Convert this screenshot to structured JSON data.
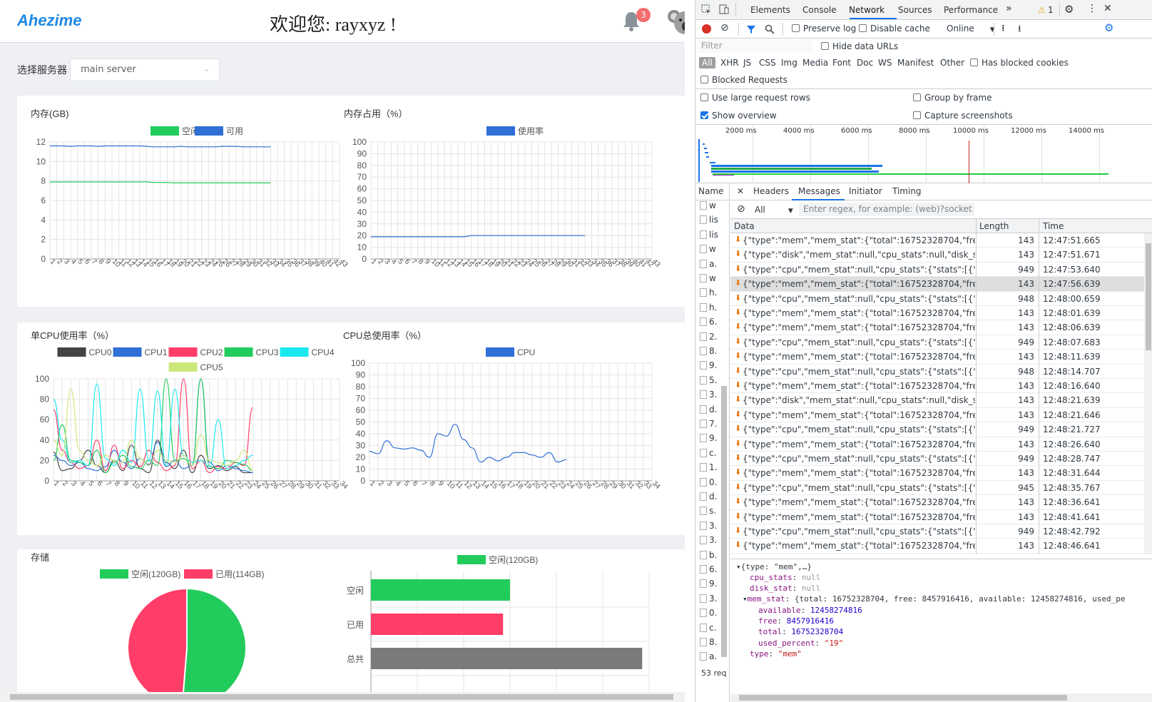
{
  "app": {
    "logo": "Ahezime",
    "welcome": "欢迎您: rayxyz !",
    "notification_count": "3",
    "server_label": "选择服务器",
    "server_value": "main server"
  },
  "charts": {
    "mem_gb": {
      "title": "内存(GB)",
      "legend": [
        "空闲",
        "可用"
      ],
      "colors": [
        "#22cc5c",
        "#2f6fd6"
      ],
      "y_ticks": [
        "0",
        "2",
        "4",
        "6",
        "8",
        "10",
        "12"
      ]
    },
    "mem_pct": {
      "title": "内存占用（%）",
      "legend": [
        "使用率"
      ],
      "colors": [
        "#2f6fd6"
      ],
      "y_ticks": [
        "0",
        "10",
        "20",
        "30",
        "40",
        "50",
        "60",
        "70",
        "80",
        "90",
        "100"
      ]
    },
    "cpu_each": {
      "title": "单CPU使用率（%）",
      "legend": [
        "CPU0",
        "CPU1",
        "CPU2",
        "CPU3",
        "CPU4",
        "CPU5"
      ],
      "colors": [
        "#444444",
        "#2f6fd6",
        "#ff3d68",
        "#22cc5c",
        "#19e8f0",
        "#cde87a"
      ],
      "y_ticks": [
        "0",
        "20",
        "40",
        "60",
        "80",
        "100"
      ]
    },
    "cpu_total": {
      "title": "CPU总使用率（%）",
      "legend": [
        "CPU"
      ],
      "colors": [
        "#2f6fd6"
      ],
      "y_ticks": [
        "0",
        "10",
        "20",
        "30",
        "40",
        "50",
        "60",
        "70",
        "80",
        "90",
        "100"
      ]
    },
    "storage": {
      "title": "存储",
      "pie_legend": [
        "空闲(120GB)",
        "已用(114GB)"
      ],
      "bar_legend": "空闲(120GB)",
      "bar_categories": [
        "空闲",
        "已用",
        "总共"
      ],
      "colors": [
        "#22cc5c",
        "#ff3d68",
        "#7a7a7a"
      ]
    }
  },
  "chart_data": [
    {
      "type": "line",
      "title": "内存(GB)",
      "x": [
        1,
        2,
        3,
        4,
        5,
        6,
        7,
        8,
        9,
        10,
        11,
        12,
        13,
        14,
        15,
        16,
        17,
        18,
        19,
        20,
        21,
        22,
        23,
        24,
        25,
        26,
        27,
        28,
        29,
        30,
        31,
        32,
        33,
        34,
        35,
        36,
        37,
        38,
        39,
        40,
        41,
        42,
        43
      ],
      "ylim": [
        0,
        12
      ],
      "series": [
        {
          "name": "空闲",
          "values": [
            7.9,
            7.9,
            7.9,
            7.9,
            7.9,
            7.9,
            7.9,
            7.9,
            7.9,
            7.9,
            7.9,
            7.9,
            7.9,
            7.9,
            7.9,
            7.85,
            7.85,
            7.85,
            7.8,
            7.8,
            7.8,
            7.8,
            7.8,
            7.8,
            7.8,
            7.8,
            7.8,
            7.8,
            7.8,
            7.8,
            7.8,
            7.8,
            7.8
          ]
        },
        {
          "name": "可用",
          "values": [
            11.6,
            11.6,
            11.6,
            11.55,
            11.6,
            11.6,
            11.6,
            11.55,
            11.6,
            11.6,
            11.6,
            11.6,
            11.6,
            11.6,
            11.55,
            11.5,
            11.5,
            11.5,
            11.5,
            11.55,
            11.5,
            11.5,
            11.5,
            11.5,
            11.5,
            11.55,
            11.55,
            11.55,
            11.5,
            11.5,
            11.5,
            11.5,
            11.5
          ]
        }
      ]
    },
    {
      "type": "line",
      "title": "内存占用（%）",
      "x": [
        1,
        2,
        3,
        4,
        5,
        6,
        7,
        8,
        9,
        10,
        11,
        12,
        13,
        14,
        15,
        16,
        17,
        18,
        19,
        20,
        21,
        22,
        23,
        24,
        25,
        26,
        27,
        28,
        29,
        30,
        31,
        32,
        33,
        34,
        35,
        36,
        37,
        38,
        39,
        40,
        41,
        42,
        43
      ],
      "ylim": [
        0,
        100
      ],
      "series": [
        {
          "name": "使用率",
          "values": [
            19,
            19,
            19,
            19,
            19,
            19,
            19,
            19,
            19,
            19,
            19,
            19,
            19,
            19,
            19,
            20,
            20,
            20,
            20,
            20,
            20,
            20,
            20,
            20,
            20,
            20,
            20,
            20,
            20,
            20,
            20,
            20,
            20
          ]
        }
      ]
    },
    {
      "type": "line",
      "title": "单CPU使用率（%）",
      "x": [
        1,
        2,
        3,
        4,
        5,
        6,
        7,
        8,
        9,
        10,
        11,
        12,
        13,
        14,
        15,
        16,
        17,
        18,
        19,
        20,
        21,
        22,
        23,
        24,
        25,
        26,
        27,
        28,
        29,
        30,
        31,
        32,
        33,
        34
      ],
      "ylim": [
        0,
        100
      ],
      "series": [
        {
          "name": "CPU0",
          "values": [
            28,
            10,
            12,
            20,
            30,
            15,
            8,
            20,
            10,
            35,
            12,
            8,
            40,
            18,
            12,
            30,
            8,
            25,
            12,
            15,
            10,
            14,
            8,
            8
          ]
        },
        {
          "name": "CPU1",
          "values": [
            25,
            20,
            15,
            18,
            12,
            10,
            14,
            30,
            18,
            12,
            22,
            16,
            38,
            14,
            20,
            12,
            15,
            100,
            18,
            10,
            15,
            12,
            10,
            8
          ]
        },
        {
          "name": "CPU2",
          "values": [
            70,
            30,
            18,
            12,
            15,
            40,
            10,
            35,
            12,
            20,
            14,
            30,
            18,
            10,
            15,
            100,
            12,
            20,
            8,
            14,
            12,
            18,
            15,
            72
          ]
        },
        {
          "name": "CPU3",
          "values": [
            20,
            55,
            20,
            18,
            15,
            30,
            8,
            18,
            25,
            14,
            12,
            20,
            15,
            100,
            20,
            22,
            15,
            100,
            14,
            12,
            20,
            18,
            16,
            10
          ]
        },
        {
          "name": "CPU4",
          "values": [
            80,
            40,
            18,
            20,
            15,
            95,
            22,
            15,
            30,
            18,
            90,
            20,
            88,
            15,
            90,
            25,
            18,
            20,
            14,
            60,
            12,
            15,
            20,
            25
          ]
        },
        {
          "name": "CPU5",
          "values": [
            40,
            25,
            90,
            30,
            20,
            15,
            25,
            20,
            18,
            40,
            22,
            15,
            30,
            20,
            18,
            25,
            15,
            45,
            20,
            18,
            15,
            20,
            30,
            10
          ]
        }
      ]
    },
    {
      "type": "line",
      "title": "CPU总使用率（%）",
      "x": [
        1,
        2,
        3,
        4,
        5,
        6,
        7,
        8,
        9,
        10,
        11,
        12,
        13,
        14,
        15,
        16,
        17,
        18,
        19,
        20,
        21,
        22,
        23,
        24,
        25,
        26,
        27,
        28,
        29,
        30,
        31,
        32,
        33,
        34
      ],
      "ylim": [
        0,
        100
      ],
      "series": [
        {
          "name": "CPU",
          "values": [
            25,
            23,
            34,
            28,
            27,
            28,
            26,
            20,
            40,
            38,
            48,
            35,
            28,
            16,
            20,
            17,
            20,
            24,
            24,
            22,
            20,
            24,
            16,
            18
          ]
        }
      ]
    },
    {
      "type": "pie",
      "title": "存储",
      "categories": [
        "空闲(120GB)",
        "已用(114GB)"
      ],
      "values": [
        120,
        114
      ]
    },
    {
      "type": "bar",
      "categories": [
        "空闲",
        "已用",
        "总共"
      ],
      "values": [
        120,
        114,
        234
      ],
      "series_name": "空闲(120GB)"
    }
  ],
  "devtools": {
    "tabs": [
      "Elements",
      "Console",
      "Network",
      "Sources",
      "Performance"
    ],
    "active_tab": "Network",
    "warning_count": "1",
    "toolbar": {
      "preserve_log": "Preserve log",
      "disable_cache": "Disable cache",
      "throttle": "Online"
    },
    "filter_placeholder": "Filter",
    "hide_data_urls": "Hide data URLs",
    "types": [
      "All",
      "XHR",
      "JS",
      "CSS",
      "Img",
      "Media",
      "Font",
      "Doc",
      "WS",
      "Manifest",
      "Other"
    ],
    "has_blocked_cookies": "Has blocked cookies",
    "blocked_requests": "Blocked Requests",
    "options": {
      "large_rows": "Use large request rows",
      "group_by_frame": "Group by frame",
      "show_overview": "Show overview",
      "capture_screenshots": "Capture screenshots"
    },
    "timeline_ticks": [
      "2000 ms",
      "4000 ms",
      "6000 ms",
      "8000 ms",
      "10000 ms",
      "12000 ms",
      "14000 ms"
    ],
    "name_header": "Name",
    "names": [
      "w",
      "lis",
      "lis",
      "w",
      "a.",
      "w",
      "h.",
      "h.",
      "6.",
      "2.",
      "8.",
      "9.",
      "5.",
      "3.",
      "d.",
      "7.",
      "9.",
      "c.",
      "1.",
      "0.",
      "d.",
      "s.",
      "3.",
      "3.",
      "b.",
      "6.",
      "9.",
      "3.",
      "0.",
      "c.",
      "8.",
      "a."
    ],
    "status": "53 req",
    "panel_tabs": [
      "Headers",
      "Messages",
      "Initiator",
      "Timing"
    ],
    "msg_filter_select": "All",
    "msg_filter_placeholder": "Enter regex, for example: (web)?socket",
    "columns": [
      "Data",
      "Length",
      "Time"
    ],
    "messages": [
      {
        "data": "{\"type\":\"mem\",\"mem_stat\":{\"total\":16752328704,\"free\":84...",
        "len": "143",
        "time": "12:47:51.665"
      },
      {
        "data": "{\"type\":\"disk\",\"mem_stat\":null,\"cpu_stats\":null,\"disk_stat\":...",
        "len": "143",
        "time": "12:47:51.671"
      },
      {
        "data": "{\"type\":\"cpu\",\"mem_stat\":null,\"cpu_stats\":{\"stats\":[{\"cpu_i...",
        "len": "949",
        "time": "12:47:53.640"
      },
      {
        "data": "{\"type\":\"mem\",\"mem_stat\":{\"total\":16752328704,\"free\":84...",
        "len": "143",
        "time": "12:47:56.639"
      },
      {
        "data": "{\"type\":\"cpu\",\"mem_stat\":null,\"cpu_stats\":{\"stats\":[{\"cpu_i...",
        "len": "948",
        "time": "12:48:00.659"
      },
      {
        "data": "{\"type\":\"mem\",\"mem_stat\":{\"total\":16752328704,\"free\":84...",
        "len": "143",
        "time": "12:48:01.639"
      },
      {
        "data": "{\"type\":\"mem\",\"mem_stat\":{\"total\":16752328704,\"free\":84...",
        "len": "143",
        "time": "12:48:06.639"
      },
      {
        "data": "{\"type\":\"cpu\",\"mem_stat\":null,\"cpu_stats\":{\"stats\":[{\"cpu_i...",
        "len": "949",
        "time": "12:48:07.683"
      },
      {
        "data": "{\"type\":\"mem\",\"mem_stat\":{\"total\":16752328704,\"free\":84...",
        "len": "143",
        "time": "12:48:11.639"
      },
      {
        "data": "{\"type\":\"cpu\",\"mem_stat\":null,\"cpu_stats\":{\"stats\":[{\"cpu_i...",
        "len": "948",
        "time": "12:48:14.707"
      },
      {
        "data": "{\"type\":\"mem\",\"mem_stat\":{\"total\":16752328704,\"free\":84...",
        "len": "143",
        "time": "12:48:16.640"
      },
      {
        "data": "{\"type\":\"disk\",\"mem_stat\":null,\"cpu_stats\":null,\"disk_stat\":...",
        "len": "143",
        "time": "12:48:21.639"
      },
      {
        "data": "{\"type\":\"mem\",\"mem_stat\":{\"total\":16752328704,\"free\":84...",
        "len": "143",
        "time": "12:48:21.646"
      },
      {
        "data": "{\"type\":\"cpu\",\"mem_stat\":null,\"cpu_stats\":{\"stats\":[{\"cpu_i...",
        "len": "949",
        "time": "12:48:21.727"
      },
      {
        "data": "{\"type\":\"mem\",\"mem_stat\":{\"total\":16752328704,\"free\":84...",
        "len": "143",
        "time": "12:48:26.640"
      },
      {
        "data": "{\"type\":\"cpu\",\"mem_stat\":null,\"cpu_stats\":{\"stats\":[{\"cpu_i...",
        "len": "949",
        "time": "12:48:28.747"
      },
      {
        "data": "{\"type\":\"mem\",\"mem_stat\":{\"total\":16752328704,\"free\":84...",
        "len": "143",
        "time": "12:48:31.644"
      },
      {
        "data": "{\"type\":\"cpu\",\"mem_stat\":null,\"cpu_stats\":{\"stats\":[{\"cpu_i...",
        "len": "945",
        "time": "12:48:35.767"
      },
      {
        "data": "{\"type\":\"mem\",\"mem_stat\":{\"total\":16752328704,\"free\":84...",
        "len": "143",
        "time": "12:48:36.641"
      },
      {
        "data": "{\"type\":\"mem\",\"mem_stat\":{\"total\":16752328704,\"free\":84...",
        "len": "143",
        "time": "12:48:41.641"
      },
      {
        "data": "{\"type\":\"cpu\",\"mem_stat\":null,\"cpu_stats\":{\"stats\":[{\"cpu_i...",
        "len": "949",
        "time": "12:48:42.792"
      },
      {
        "data": "{\"type\":\"mem\",\"mem_stat\":{\"total\":16752328704,\"free\":84...",
        "len": "143",
        "time": "12:48:46.641"
      }
    ],
    "detail": {
      "root": "{type: \"mem\",…}",
      "cpu_stats": "null",
      "disk_stat": "null",
      "mem_stat_summary": "{total: 16752328704, free: 8457916416, available: 12458274816, used_pe",
      "available": "12458274816",
      "free": "8457916416",
      "total": "16752328704",
      "used_percent": "\"19\"",
      "type": "\"mem\""
    }
  }
}
